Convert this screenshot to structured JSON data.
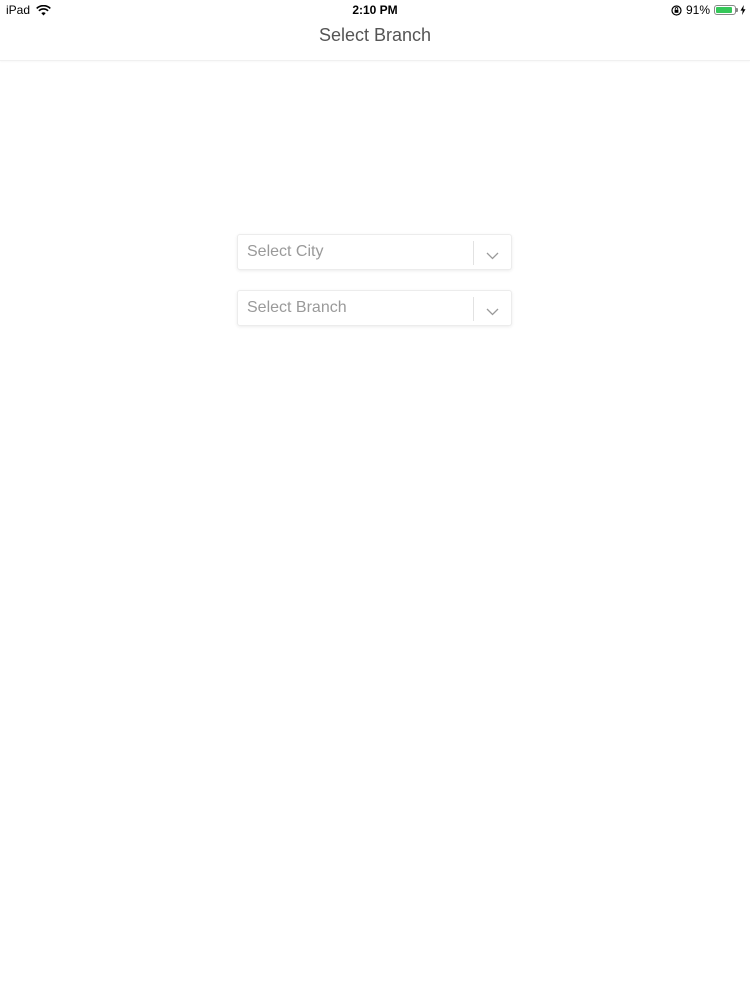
{
  "status_bar": {
    "device": "iPad",
    "time": "2:10 PM",
    "battery_percent": "91%",
    "battery_level": 0.91,
    "wifi_icon": "wifi-icon",
    "rotation_lock_icon": "rotation-lock-icon",
    "charging_icon": "charging-icon",
    "battery_color": "#35c759"
  },
  "nav_bar": {
    "title": "Select Branch"
  },
  "form": {
    "city": {
      "placeholder": "Select City",
      "icon": "chevron-down-icon"
    },
    "branch": {
      "placeholder": "Select Branch",
      "icon": "chevron-down-icon"
    }
  }
}
